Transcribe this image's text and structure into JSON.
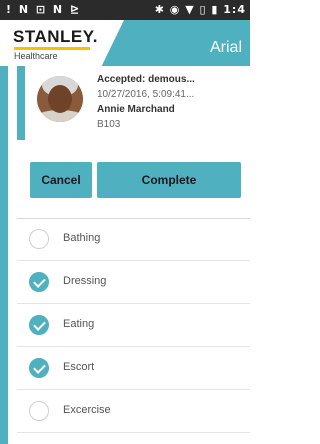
{
  "status_bar": {
    "left_icons": "! N ⊡ N ⊵",
    "right_icons": "✱ ◉ ▼ ▯ ▮ 1:4"
  },
  "header": {
    "logo_text": "STANLEY.",
    "logo_subtext": "Healthcare",
    "product_name": "Arial",
    "accent_color": "#4fb1bf",
    "logo_stripe_color": "#f3c300"
  },
  "call_card": {
    "status": "Accepted: demous...",
    "timestamp": "10/27/2016, 5:09:41...",
    "resident_name": "Annie Marchand",
    "room": "B103",
    "cancel_label": "Cancel",
    "complete_label": "Complete"
  },
  "tasks": [
    {
      "label": "Bathing",
      "checked": false
    },
    {
      "label": "Dressing",
      "checked": true
    },
    {
      "label": "Eating",
      "checked": true
    },
    {
      "label": "Escort",
      "checked": true
    },
    {
      "label": "Excercise",
      "checked": false
    }
  ]
}
